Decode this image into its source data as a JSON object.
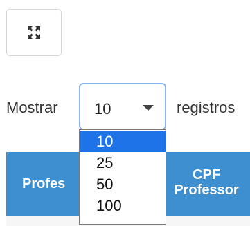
{
  "toolbar": {
    "fullscreen_icon": "expand-arrows-icon"
  },
  "length_control": {
    "label_before": "Mostrar",
    "selected_value": "10",
    "label_after": "registros",
    "options": [
      "10",
      "25",
      "50",
      "100"
    ],
    "highlighted_option": "10"
  },
  "table": {
    "headers": [
      {
        "label": "Profes"
      },
      {
        "label_line1": "CPF",
        "label_line2": "Professor"
      }
    ]
  },
  "colors": {
    "header_bg": "#3d8fd0",
    "option_highlight": "#1e73e8",
    "select_border": "#8ab4e8"
  }
}
